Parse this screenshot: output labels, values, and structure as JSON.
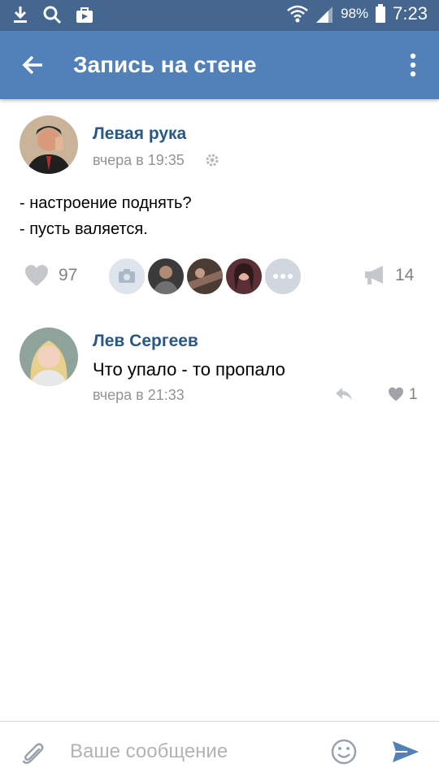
{
  "status_bar": {
    "battery": "98%",
    "time": "7:23"
  },
  "header": {
    "title": "Запись на стене"
  },
  "post": {
    "author": "Левая рука",
    "time": "вчера в 19:35",
    "text_lines": [
      "- настроение поднять?",
      "- пусть валяется."
    ],
    "likes": "97",
    "shares": "14"
  },
  "comment": {
    "author": "Лев Сергеев",
    "text": "Что упало - то пропало",
    "time": "вчера в 21:33",
    "likes": "1"
  },
  "composer": {
    "placeholder": "Ваше сообщение"
  },
  "colors": {
    "status_bar": "#45678f",
    "header": "#5181b8",
    "link": "#2a5885",
    "muted": "#939393"
  }
}
